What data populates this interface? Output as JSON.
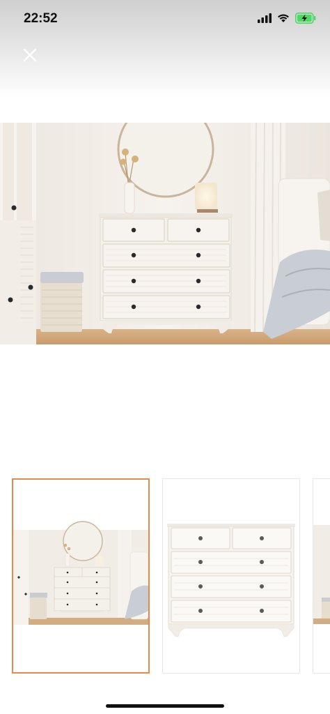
{
  "status_bar": {
    "time": "22:52",
    "icons": [
      "cellular-signal-icon",
      "wifi-icon",
      "battery-charging-icon"
    ],
    "battery_color": "#4cd964"
  },
  "header": {
    "close_icon": "close-icon"
  },
  "gallery": {
    "selected_index": 0,
    "thumbnails": [
      {
        "name": "bedroom-scene",
        "selected": true
      },
      {
        "name": "dresser-white-background",
        "selected": false
      },
      {
        "name": "partial-next-image",
        "selected": false
      }
    ]
  },
  "colors": {
    "selection_border": "#e58a4e",
    "furniture_white": "#f4f0ea",
    "wall": "#f1ece6",
    "floor": "#d9b48a"
  }
}
